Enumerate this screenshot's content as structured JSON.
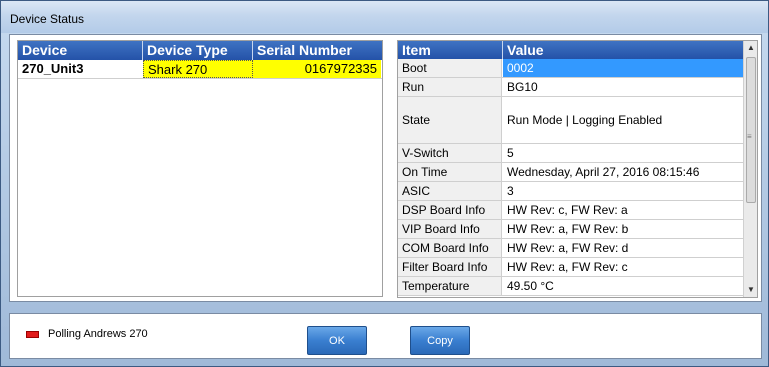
{
  "window": {
    "title": "Device Status"
  },
  "devices": {
    "columns": [
      "Device",
      "Device Type",
      "Serial Number"
    ],
    "rows": [
      {
        "device": "270_Unit3",
        "type": "Shark 270",
        "serial": "0167972335"
      }
    ]
  },
  "properties": {
    "columns": [
      "Item",
      "Value"
    ],
    "rows": [
      {
        "item": "Boot",
        "value": "0002"
      },
      {
        "item": "Run",
        "value": "BG10"
      },
      {
        "item": "State",
        "value": "Run Mode | Logging Enabled"
      },
      {
        "item": "V-Switch",
        "value": "5"
      },
      {
        "item": "On Time",
        "value": "Wednesday, April 27, 2016 08:15:46"
      },
      {
        "item": "ASIC",
        "value": "3"
      },
      {
        "item": "DSP Board Info",
        "value": "HW Rev: c, FW Rev: a"
      },
      {
        "item": "VIP Board Info",
        "value": "HW Rev: a, FW Rev: b"
      },
      {
        "item": "COM Board Info",
        "value": "HW Rev: a, FW Rev: d"
      },
      {
        "item": "Filter Board Info",
        "value": "HW Rev: a, FW Rev: c"
      },
      {
        "item": "Temperature",
        "value": "49.50 °C"
      }
    ]
  },
  "footer": {
    "status_text": "Polling Andrews 270",
    "status_color": "#e21b1b",
    "ok_label": "OK",
    "copy_label": "Copy"
  },
  "colors": {
    "header_blue": "#2f5fb3",
    "selection": "#3399ff",
    "highlight": "#ffff00"
  }
}
